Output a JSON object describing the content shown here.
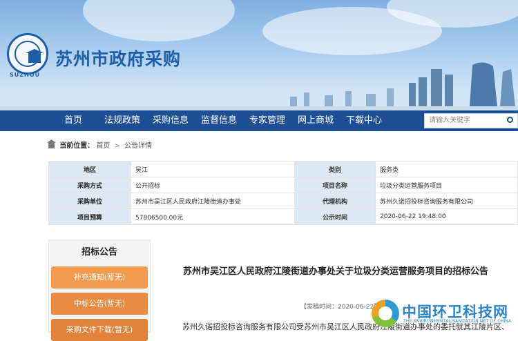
{
  "header": {
    "site_title": "苏州市政府采购",
    "logo_sub": "SUZHOU"
  },
  "nav": {
    "items": [
      "首页",
      "法规政策",
      "采购信息",
      "监督信息",
      "专家管理",
      "网上商城",
      "下载中心"
    ],
    "search_placeholder": "请输入关键字"
  },
  "breadcrumb": {
    "label": "当前位置：",
    "home": "首页",
    "sep": ">",
    "current": "公告详情"
  },
  "info": {
    "rows": [
      {
        "l1": "地区",
        "v1": "吴江",
        "l2": "类别",
        "v2": "服务类"
      },
      {
        "l1": "采购方式",
        "v1": "公开招标",
        "l2": "项目名称",
        "v2": "垃圾分类运营服务项目"
      },
      {
        "l1": "采购单位",
        "v1": "苏州市吴江区人民政府江陵街道办事处",
        "l2": "代理机构",
        "v2": "苏州久诺招投标咨询服务有限公司"
      },
      {
        "l1": "项目预算",
        "v1": "57806500.00元",
        "l2": "公示时间",
        "v2": "2020-06-22 19:48:00"
      }
    ]
  },
  "sidebar": {
    "heading": "招标公告",
    "buttons": [
      "补充通知(暂无)",
      "中标公告(暂无)",
      "采购文件下载(暂无)"
    ]
  },
  "article": {
    "title": "苏州市吴江区人民政府江陵街道办事处关于垃圾分类运营服务项目的招标公告",
    "meta": "【发稿时间：2020-06-22】",
    "body": "苏州久诺招投标咨询服务有限公司受苏州市吴江区人民政府江陵街道办事处的委托就其江陵片区、"
  },
  "watermark": {
    "text": "中国环卫科技网",
    "sub": "THE ENVIRONMENTAL SANITATION NET OF CHINA"
  },
  "colors": {
    "nav_bg": "#1c4f94",
    "label_bg": "#dde8f5",
    "orange": "#f29a4e",
    "title_blue": "#1d5ea8"
  }
}
